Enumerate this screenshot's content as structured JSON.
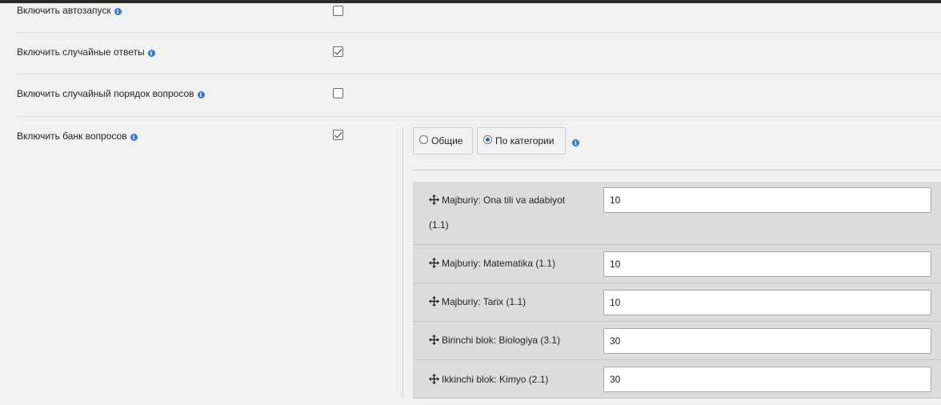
{
  "settings": [
    {
      "label": "Включить автозапуск",
      "checked": false
    },
    {
      "label": "Включить случайные ответы",
      "checked": true
    },
    {
      "label": "Включить случайный порядок вопросов",
      "checked": false
    },
    {
      "label": "Включить банк вопросов",
      "checked": true
    }
  ],
  "bank_mode": {
    "options": [
      {
        "label": "Общие",
        "selected": false
      },
      {
        "label": "По категории",
        "selected": true
      }
    ]
  },
  "categories": [
    {
      "label_line1": "Majburiy: Ona tili va adabiyot",
      "label_line2": "(1.1)",
      "value": "10"
    },
    {
      "label_line1": "Majburiy: Matematika (1.1)",
      "label_line2": "",
      "value": "10"
    },
    {
      "label_line1": "Majburiy: Tarix (1.1)",
      "label_line2": "",
      "value": "10"
    },
    {
      "label_line1": "Birinchi blok: Biologiya (3.1)",
      "label_line2": "",
      "value": "30"
    },
    {
      "label_line1": "Ikkinchi blok: Kimyo (2.1)",
      "label_line2": "",
      "value": "30"
    }
  ],
  "icons": {
    "info": "info-icon",
    "move": "move-arrows-icon"
  },
  "colors": {
    "info_blue": "#2f7bd9",
    "radio_blue": "#1a64c4"
  }
}
